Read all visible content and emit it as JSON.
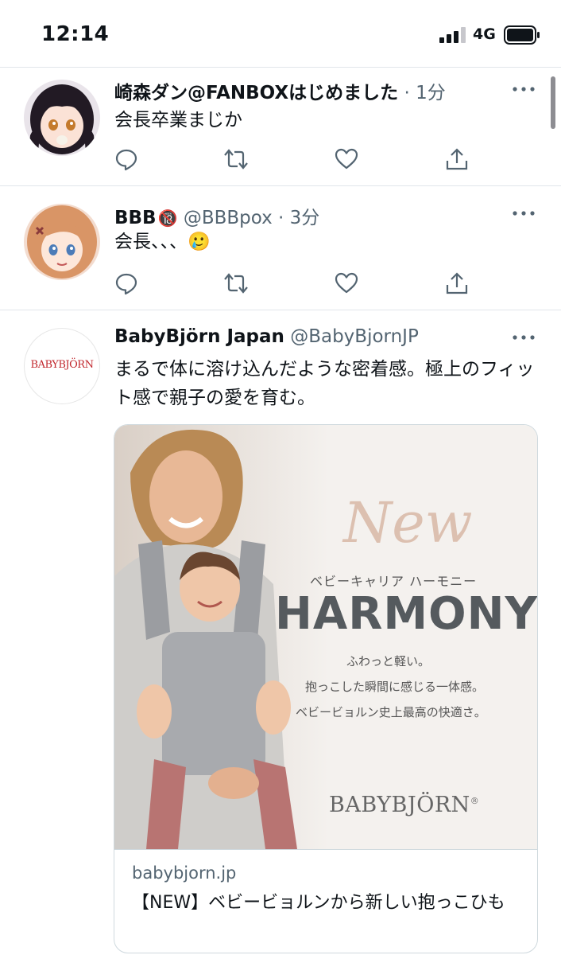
{
  "status_bar": {
    "time": "12:14",
    "network": "4G"
  },
  "tweets": [
    {
      "name": "崎森ダン@FANBOXはじめました",
      "handle": "",
      "separator": "·",
      "time": "1分",
      "text": "会長卒業まじか"
    },
    {
      "name": "BBB",
      "name_badge": "🔞",
      "handle": "@BBBpox",
      "separator": "·",
      "time": "3分",
      "text": "会長、、、🥲"
    },
    {
      "name": "BabyBjörn Japan",
      "handle": "@BabyBjornJP",
      "avatar_text": "BABYBJÖRN",
      "text": "まるで体に溶け込んだような密着感。極上のフィット感で親子の愛を育む。",
      "card": {
        "ad": {
          "new": "New",
          "subtitle": "ベビーキャリア ハーモニー",
          "product": "HARMONY",
          "line1": "ふわっと軽い。",
          "line2": "抱っこした瞬間に感じる一体感。",
          "line3": "ベビービョルン史上最高の快適さ。",
          "logo": "BABYBJÖRN",
          "logo_mark": "®"
        },
        "domain": "babybjorn.jp",
        "title": "【NEW】ベビービョルンから新しい抱っこひも"
      }
    }
  ],
  "icons": {
    "reply": "reply-icon",
    "retweet": "retweet-icon",
    "like": "heart-icon",
    "share": "share-icon",
    "more": "more-icon"
  },
  "colors": {
    "secondary_text": "#536471",
    "divider": "#e1e6ea",
    "icon": "#536471",
    "brand_red": "#c1272d"
  }
}
